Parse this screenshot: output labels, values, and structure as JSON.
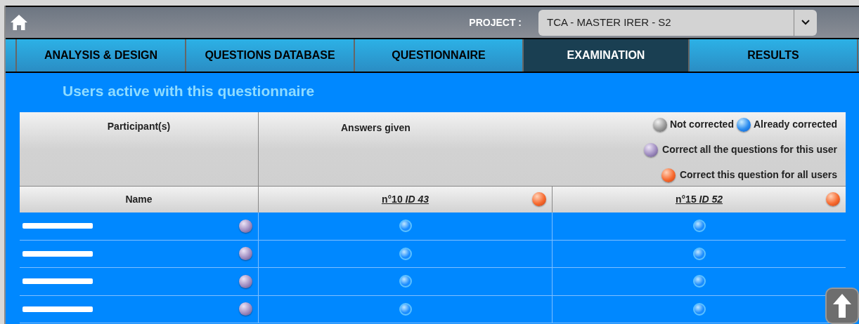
{
  "header": {
    "project_label": "PROJECT :",
    "project_value": "TCA - MASTER IRER - S2"
  },
  "tabs": [
    {
      "label": "ANALYSIS & DESIGN",
      "selected": false
    },
    {
      "label": "QUESTIONS DATABASE",
      "selected": false
    },
    {
      "label": "QUESTIONNAIRE",
      "selected": false
    },
    {
      "label": "EXAMINATION",
      "selected": true
    },
    {
      "label": "RESULTS",
      "selected": false
    }
  ],
  "section_title": "Users active with this questionnaire",
  "table": {
    "participants_heading": "Participant(s)",
    "answers_heading": "Answers given",
    "legend": [
      {
        "kind": "not-corrected",
        "label": "Not corrected"
      },
      {
        "kind": "corrected",
        "label": "Already corrected"
      },
      {
        "kind": "correct-user",
        "label": "Correct all the questions for this user"
      },
      {
        "kind": "correct-question",
        "label": "Correct this question for all users"
      }
    ],
    "name_column": "Name",
    "question_columns": [
      "n°10 *ID 43*",
      "n°15 *ID 52*"
    ],
    "rows": [
      {
        "answers": [
          {
            "corrected": true
          },
          {
            "corrected": true
          }
        ]
      },
      {
        "answers": [
          {
            "corrected": true
          },
          {
            "corrected": true
          }
        ]
      },
      {
        "answers": [
          {
            "corrected": true
          },
          {
            "corrected": true
          }
        ]
      },
      {
        "answers": [
          {
            "corrected": true
          },
          {
            "corrected": true
          }
        ]
      }
    ]
  }
}
